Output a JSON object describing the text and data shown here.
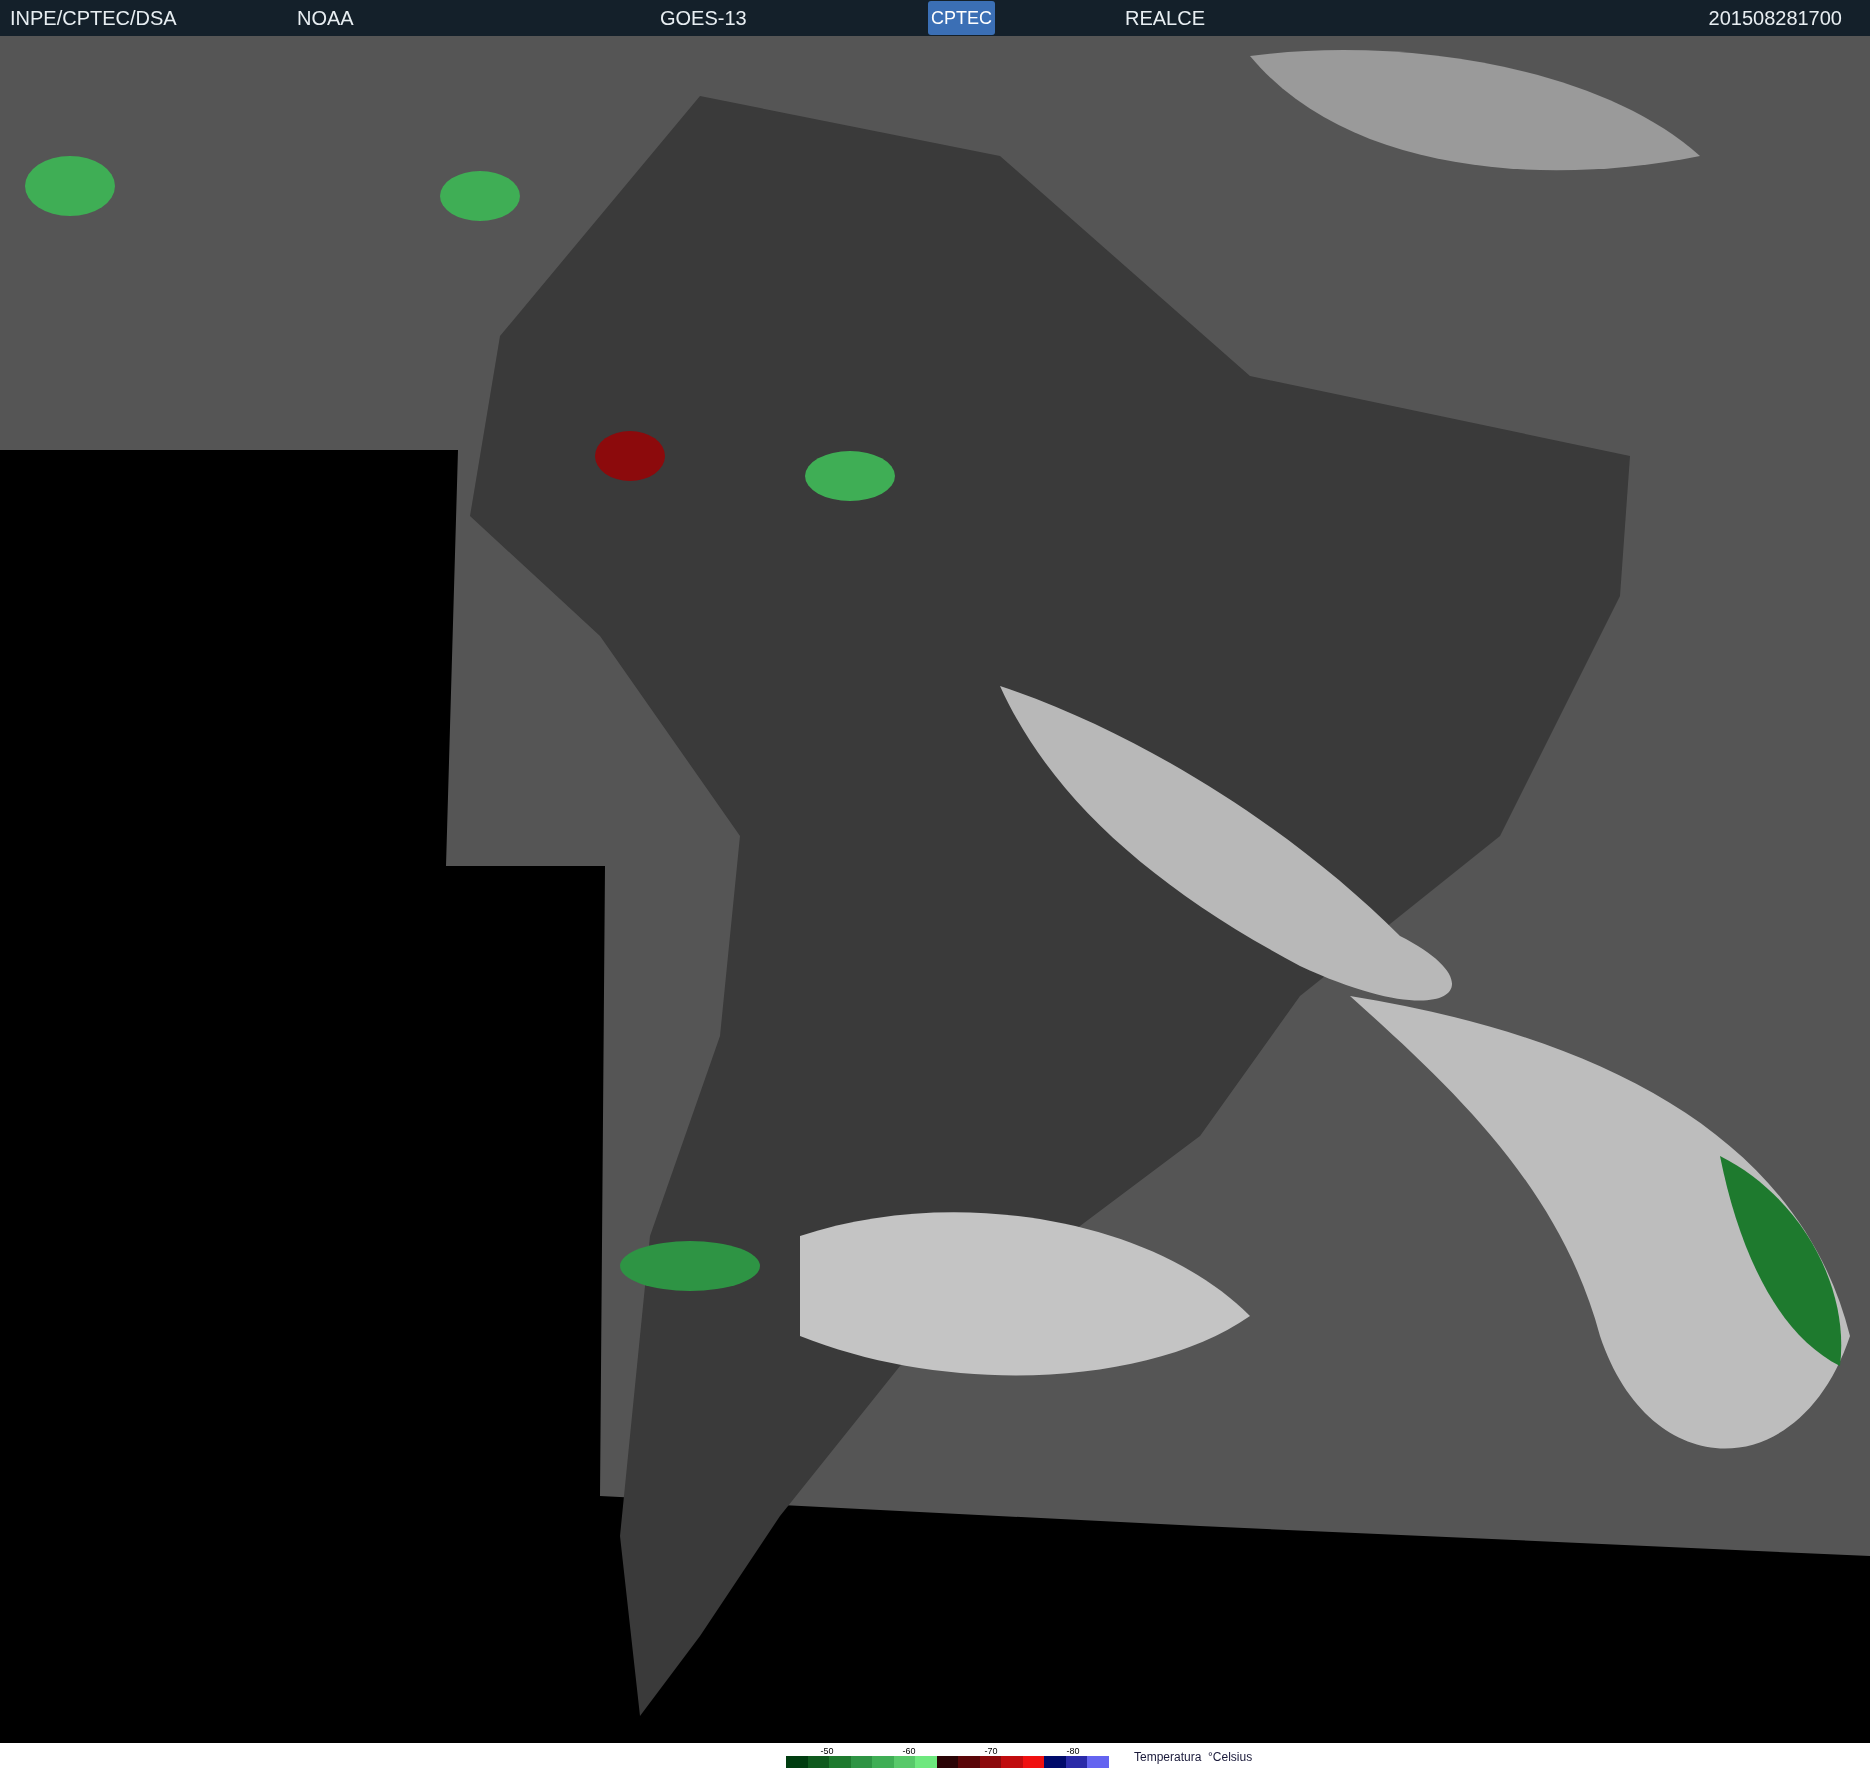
{
  "header": {
    "items": [
      "INPE/CPTEC/DSA",
      "NOAA",
      "GOES-13"
    ],
    "logo": "CPTEC",
    "product": "REALCE",
    "timestamp": "201508281700"
  },
  "legend": {
    "ticks": [
      "-50",
      "-60",
      "-70",
      "-80"
    ],
    "title": "Temperatura  °Celsius",
    "swatches": [
      {
        "color": "#003d10"
      },
      {
        "color": "#0f5a1e"
      },
      {
        "color": "#1e7a2e"
      },
      {
        "color": "#2e9444"
      },
      {
        "color": "#3fae55"
      },
      {
        "color": "#58c96a"
      },
      {
        "color": "#6ee87e"
      },
      {
        "color": "#2a0406"
      },
      {
        "color": "#5a0608"
      },
      {
        "color": "#8c0a0c"
      },
      {
        "color": "#c00c0e"
      },
      {
        "color": "#f01010"
      },
      {
        "color": "#000a6a"
      },
      {
        "color": "#2a2aa8"
      },
      {
        "color": "#6464f0"
      }
    ]
  }
}
